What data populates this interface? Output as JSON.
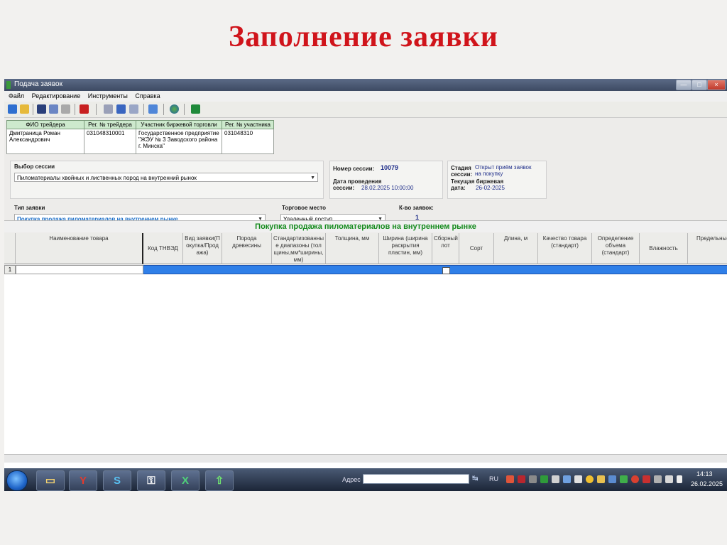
{
  "slide": {
    "title": "Заполнение заявки"
  },
  "window": {
    "title": "Подача заявок",
    "min_glyph": "—",
    "max_glyph": "□",
    "close_glyph": "×"
  },
  "menu": [
    "Файл",
    "Редактирование",
    "Инструменты",
    "Справка"
  ],
  "toolbar": {
    "icons": [
      "exit-icon",
      "open-folder-icon",
      "save-icon",
      "copy-icon",
      "print-icon",
      "delete-icon",
      "find-icon",
      "back-icon",
      "forward-icon",
      "send-icon",
      "globe-icon",
      "excel-icon"
    ]
  },
  "trader": {
    "headers": [
      "ФИО трейдера",
      "Рег. № трейдера",
      "Участник биржевой торговли",
      "Рег. № участника"
    ],
    "row": [
      "Дмитраница Роман Александрович",
      "031048310001",
      "Государственное предприятие \"ЖЭУ № 3 Заводского района г. Минска\"",
      "031048310"
    ]
  },
  "session": {
    "label": "Выбор сессии",
    "value": "Пиломатериалы хвойных и лиственных пород на внутренний рынок",
    "number_label": "Номер сессии:",
    "number": "10079",
    "date_label_1": "Дата проведения",
    "date_label_2": "сессии:",
    "date": "28.02.2025 10:00:00",
    "stage_label_1": "Стадия",
    "stage_label_2": "сессии:",
    "stage_value_1": "Открыт приём заявок",
    "stage_value_2": "на покупку",
    "current_date_label_1": "Текущая биржевая",
    "current_date_label_2": "дата:",
    "current_date": "26-02-2025"
  },
  "order": {
    "type_label": "Тип заявки",
    "type_value": "Покупка продажа пиломатериалов на внутреннем рынке",
    "place_label": "Торговое место",
    "place_value": "Удаленный доступ",
    "count_label": "К-во заявок:",
    "count": "1"
  },
  "grid": {
    "title": "Покупка продажа пиломатериалов на внутреннем рынке",
    "columns": [
      "Наименование товара",
      "Код ТНВЭД",
      "Вид заявки(Покупка/Продажа)",
      "Порода древесины",
      "Стандартизованные диапазоны (толщины,мм*ширины,мм)",
      "Толщина, мм",
      "Ширина (ширина раскрытия пластин, мм)",
      "Сборный лот",
      "Сорт",
      "Длина, м",
      "Качество товара (стандарт)",
      "Определение объема (стандарт)",
      "Влажность",
      "Предельные отклонения"
    ],
    "row_number": "1"
  },
  "taskbar": {
    "apps": [
      {
        "name": "explorer-icon",
        "glyph": "▭"
      },
      {
        "name": "yandex-browser-icon",
        "glyph": "Y"
      },
      {
        "name": "skype-icon",
        "glyph": "S"
      },
      {
        "name": "keys-icon",
        "glyph": "⚿"
      },
      {
        "name": "excel-icon",
        "glyph": "X"
      },
      {
        "name": "upload-app-icon",
        "glyph": "⇧"
      }
    ],
    "address_label": "Адрес",
    "lang": "RU",
    "time": "14:13",
    "date": "26.02.2025"
  },
  "colors": {
    "title_red": "#d0141b",
    "section_green": "#138a1c",
    "selection_blue": "#2f7fe8",
    "link_blue": "#1f2e8a"
  }
}
